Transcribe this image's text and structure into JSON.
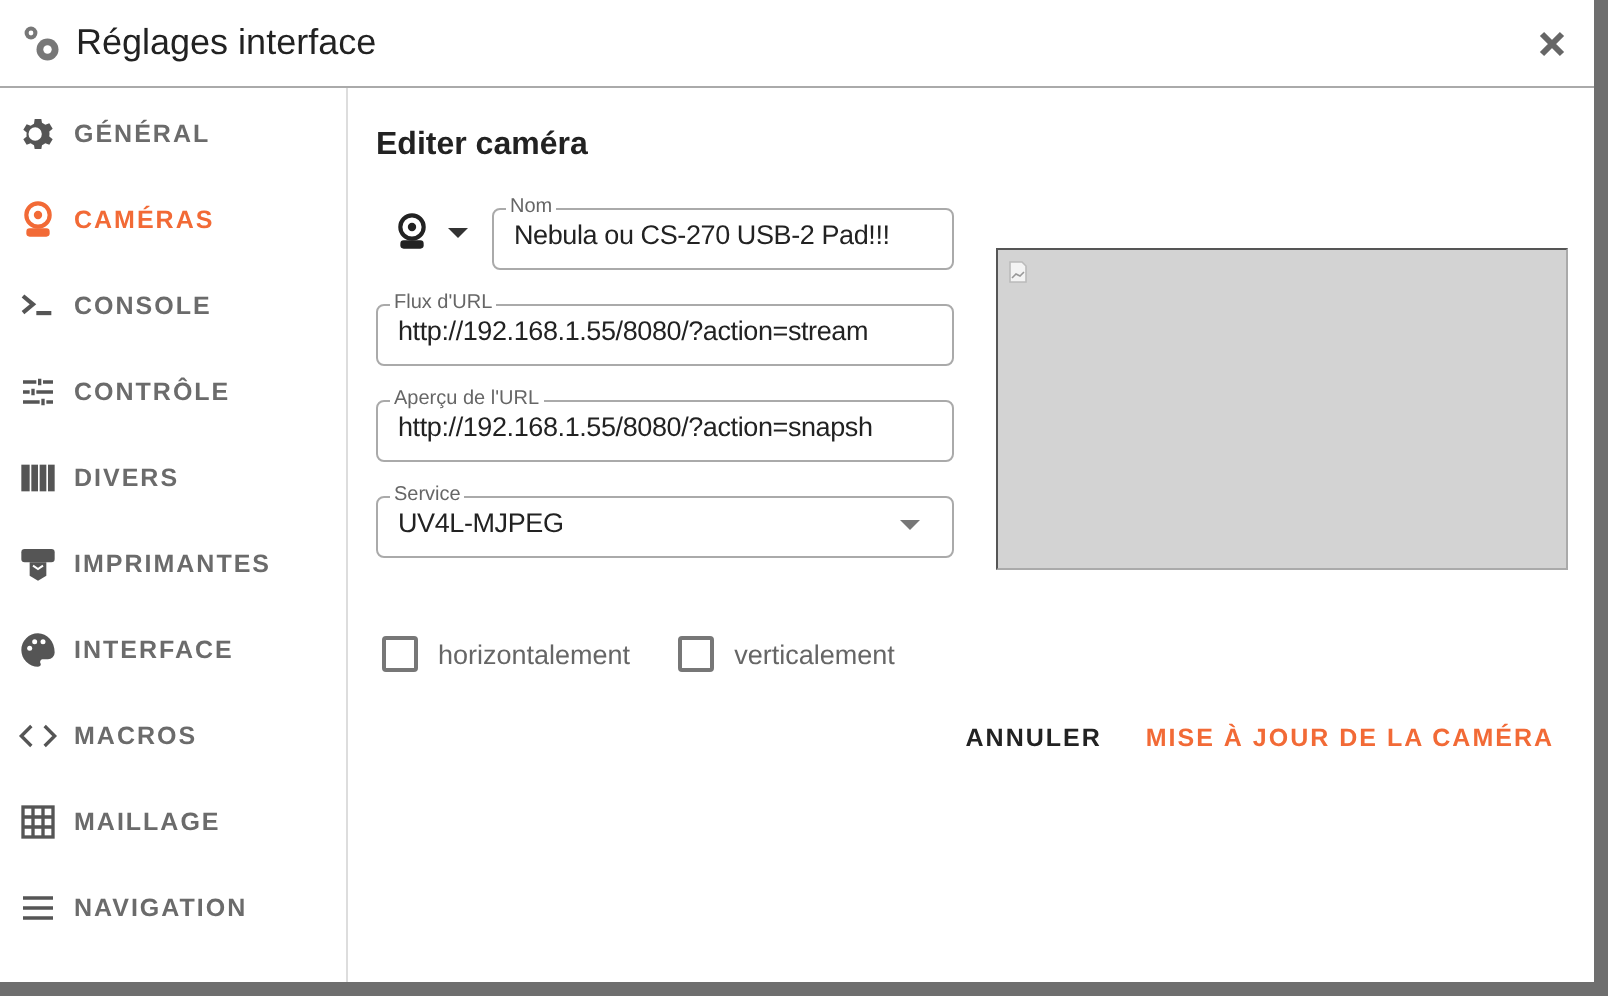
{
  "window": {
    "title": "Réglages interface"
  },
  "sidebar": {
    "items": [
      {
        "label": "GÉNÉRAL",
        "kind": "gear",
        "selected": false
      },
      {
        "label": "CAMÉRAS",
        "kind": "webcam",
        "selected": true
      },
      {
        "label": "CONSOLE",
        "kind": "console",
        "selected": false
      },
      {
        "label": "CONTRÔLE",
        "kind": "tune",
        "selected": false
      },
      {
        "label": "DIVERS",
        "kind": "books",
        "selected": false
      },
      {
        "label": "IMPRIMANTES",
        "kind": "printer",
        "selected": false
      },
      {
        "label": "INTERFACE",
        "kind": "palette",
        "selected": false
      },
      {
        "label": "MACROS",
        "kind": "code",
        "selected": false
      },
      {
        "label": "MAILLAGE",
        "kind": "grid",
        "selected": false
      },
      {
        "label": "NAVIGATION",
        "kind": "menu",
        "selected": false
      }
    ]
  },
  "form": {
    "heading": "Editer caméra",
    "name": {
      "label": "Nom",
      "value": "Nebula ou CS-270 USB-2 Pad!!!"
    },
    "stream_url": {
      "label": "Flux d'URL",
      "value": "http://192.168.1.55/8080/?action=stream"
    },
    "snapshot_url": {
      "label": "Aperçu de l'URL",
      "value": "http://192.168.1.55/8080/?action=snapsh"
    },
    "service": {
      "label": "Service",
      "value": "UV4L-MJPEG"
    },
    "flips": [
      {
        "label": "horizontalement",
        "checked": false
      },
      {
        "label": "verticalement",
        "checked": false
      }
    ],
    "buttons": [
      {
        "label": "ANNULER",
        "kind": "plain"
      },
      {
        "label": "MISE À JOUR DE LA CAMÉRA",
        "kind": "primary"
      }
    ]
  }
}
